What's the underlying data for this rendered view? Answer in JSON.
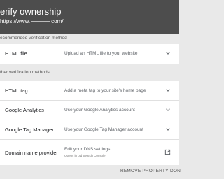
{
  "header": {
    "title": "erify ownership",
    "url_prefix": "https://www.",
    "url_suffix": "com/"
  },
  "recommended": {
    "label": "ecommended verification method",
    "items": [
      {
        "method": "HTML file",
        "description": "Upload an HTML file to your website",
        "icon": "chevron-down-icon"
      }
    ]
  },
  "other": {
    "label": "ther verification methods",
    "items": [
      {
        "method": "HTML tag",
        "description": "Add a meta tag to your site's home page",
        "icon": "chevron-down-icon"
      },
      {
        "method": "Google Analytics",
        "description": "Use your Google Analytics account",
        "icon": "chevron-down-icon"
      },
      {
        "method": "Google Tag Manager",
        "description": "Use your Google Tag Manager account",
        "icon": "chevron-down-icon"
      },
      {
        "method": "Domain name provider",
        "description": "Edit your DNS settings",
        "note": "Opens in old Search Console",
        "icon": "external-link-icon"
      }
    ]
  },
  "footer": {
    "remove_label": "REMOVE PROPERTY",
    "done_label": "DON"
  },
  "colors": {
    "header_bg": "#4d4d4d",
    "page_bg": "#e9e9e9",
    "card_bg": "#ffffff"
  }
}
